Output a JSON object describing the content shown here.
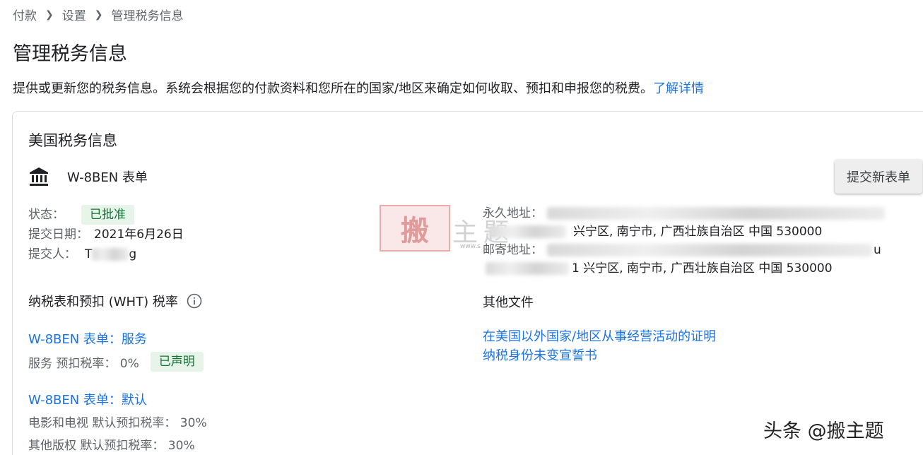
{
  "breadcrumb": [
    "付款",
    "设置",
    "管理税务信息"
  ],
  "page_title": "管理税务信息",
  "description": {
    "text": "提供或更新您的税务信息。系统会根据您的付款资料和您所在的国家/地区来确定如何收取、预扣和申报您的税费。",
    "link": "了解详情"
  },
  "us_tax": {
    "title": "美国税务信息",
    "form_name": "W-8BEN 表单",
    "submit_button": "提交新表单",
    "status_label": "状态：",
    "status_value": "已批准",
    "date_label": "提交日期：",
    "date_value": "2021年6月26日",
    "submitter_label": "提交人：",
    "submitter_prefix": "T",
    "submitter_suffix": "g",
    "permanent_address_label": "永久地址：",
    "permanent_address_line2": "兴宁区, 南宁市, 广西壮族自治区 中国 530000",
    "mailing_address_label": "邮寄地址：",
    "mailing_address_line1_tail": "u",
    "mailing_address_line2": "1 兴宁区, 南宁市, 广西壮族自治区 中国 530000"
  },
  "wht": {
    "title": "纳税表和预扣 (WHT) 税率",
    "form1_link": "W-8BEN 表单：服务",
    "form1_rate": "服务 预扣税率： 0%",
    "form1_badge": "已声明",
    "form2_link": "W-8BEN 表单：默认",
    "form2_rate1": "电影和电视 默认预扣税率： 30%",
    "form2_rate2": "其他版权 默认预扣税率： 30%"
  },
  "other_docs": {
    "title": "其他文件",
    "link1": "在美国以外国家/地区从事经营活动的证明",
    "link2": "纳税身份未变宣誓书"
  },
  "watermarks": {
    "stamp": "搬",
    "text": "主题",
    "url": "www.s",
    "corner": "头条 @搬主题"
  },
  "colors": {
    "link": "#1a73e8",
    "badge_bg": "#e6f4ea",
    "badge_text": "#137333"
  }
}
